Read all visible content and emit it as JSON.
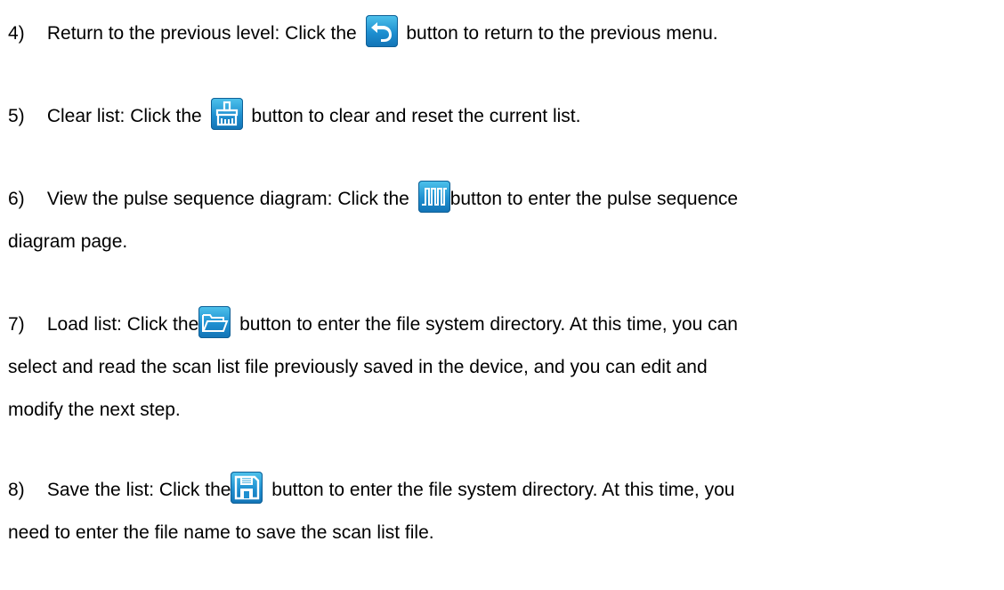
{
  "items": [
    {
      "number": "4)",
      "before": "Return to the previous level: Click the",
      "icon": "return-icon",
      "after": "button to return to the previous menu."
    },
    {
      "number": "5)",
      "before": "Clear list: Click the",
      "icon": "brush-icon",
      "after": "button to clear and reset the current list."
    },
    {
      "number": "6)",
      "before": "View the pulse sequence diagram: Click the",
      "icon": "pulse-sequence-icon",
      "after": "button to enter the pulse sequence",
      "continuation": "diagram page."
    },
    {
      "number": "7)",
      "before": "Load list: Click the",
      "icon": "folder-icon",
      "after": "button to enter the file system directory. At this time, you can",
      "continuation": "select and read the scan list file previously saved in the device, and you can edit and",
      "continuation2": "modify the next step."
    },
    {
      "number": "8)",
      "before": "Save the list: Click the",
      "icon": "save-icon",
      "after": "button to enter the file system directory. At this time, you",
      "continuation": "need to enter the file name to save the scan list file."
    }
  ],
  "colors": {
    "icon_top": "#4fc3ec",
    "icon_bottom": "#1373b5",
    "text": "#000000"
  }
}
